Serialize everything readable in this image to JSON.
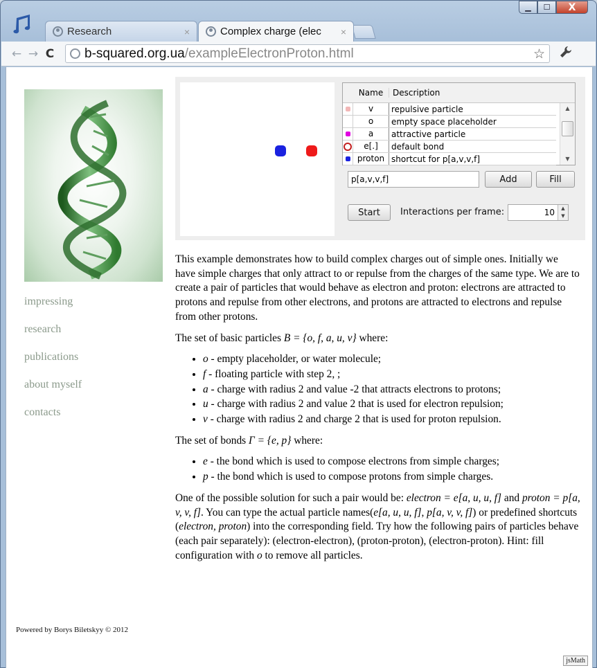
{
  "browser": {
    "tabs": [
      {
        "title": "Research",
        "active": false,
        "close": "×"
      },
      {
        "title": "Complex charge (elec",
        "active": true,
        "close": "×"
      }
    ],
    "url": {
      "host": "b-squared.org.ua",
      "path": "/exampleElectronProton.html"
    },
    "nav": {
      "back": "←",
      "forward": "→",
      "reload": "C"
    },
    "icons": {
      "star": "☆",
      "wrench": "🔧"
    },
    "window_buttons": {
      "minimize": "▁",
      "maximize": "☐",
      "close": "X"
    }
  },
  "sidebar": {
    "links": [
      "impressing",
      "research",
      "publications",
      "about myself",
      "contacts"
    ],
    "footer": "Powered by Borys Biletskyy © 2012"
  },
  "applet": {
    "particles": [
      {
        "name": "proton",
        "color": "#1a22e0"
      },
      {
        "name": "electron",
        "color": "#ee1a1a"
      }
    ],
    "table": {
      "headers": [
        "Name",
        "Description"
      ],
      "rows": [
        {
          "name": "v",
          "desc": "repulsive particle",
          "swatch": "#f2b7b7",
          "type": "dot"
        },
        {
          "name": "o",
          "desc": "empty space placeholder",
          "swatch": "",
          "type": "none"
        },
        {
          "name": "a",
          "desc": "attractive particle",
          "swatch": "#e000e0",
          "type": "dot"
        },
        {
          "name": "e[.]",
          "desc": "default bond",
          "swatch": "#c32020",
          "type": "ring"
        },
        {
          "name": "proton",
          "desc": "shortcut for p[a,v,v,f]",
          "swatch": "#1a22e0",
          "type": "dot"
        }
      ]
    },
    "input_value": "p[a,v,v,f]",
    "add_label": "Add",
    "fill_label": "Fill",
    "start_label": "Start",
    "ipf_label": "Interactions per frame:",
    "ipf_value": "10"
  },
  "article": {
    "intro": "This example demonstrates how to build complex charges out of simple ones. Initially we have simple charges that only attract to or repulse from the charges of the same type. We are to create a pair of particles that would behave as electron and proton: electrons are attracted to protons and repulse from other electrons, and protons are attracted to electrons and repulse from other protons.",
    "basic_set_text": "The set of basic particles ",
    "basic_set_formula": "B = {o, f, a, u, v}",
    "basic_set_suffix": " where:",
    "basic_items": [
      {
        "sym": "o",
        "text": " - empty placeholder, or water molecule;"
      },
      {
        "sym": "f",
        "text": " - floating particle with step 2, ;"
      },
      {
        "sym": "a",
        "text": " - charge with radius 2 and value -2 that attracts electrons to protons;"
      },
      {
        "sym": "u",
        "text": " - charge with radius 2 and value 2 that is used for electron repulsion;"
      },
      {
        "sym": "v",
        "text": " - charge with radius 2 and charge 2 that is used for proton repulsion."
      }
    ],
    "bonds_text": "The set of bonds ",
    "bonds_formula": "Γ = {e, p}",
    "bonds_suffix": " where:",
    "bond_items": [
      {
        "sym": "e",
        "text": " - the bond which is used to compose electrons from simple charges;"
      },
      {
        "sym": "p",
        "text": " - the bond which is used to compose protons from simple charges."
      }
    ],
    "solution": {
      "t1": "One of the possible solution for such a pair would be: ",
      "f1": "electron = e[a, u, u, f]",
      "t2": " and ",
      "f2": "proton = p[a, v, v, f]",
      "t3": ". You can type the actual particle names(",
      "f3": "e[a, u, u, f]",
      "t4": ", ",
      "f4": "p[a, v, v, f]",
      "t5": ") or predefined shortcuts (",
      "f5": "electron, proton",
      "t6": ") into the corresponding field. Try how the following pairs of particles behave (each pair separately): (electron-electron), (proton-proton), (electron-proton). Hint: fill configuration with ",
      "f6": "o",
      "t7": " to remove all particles."
    }
  },
  "jsmath_badge": "jsMath"
}
